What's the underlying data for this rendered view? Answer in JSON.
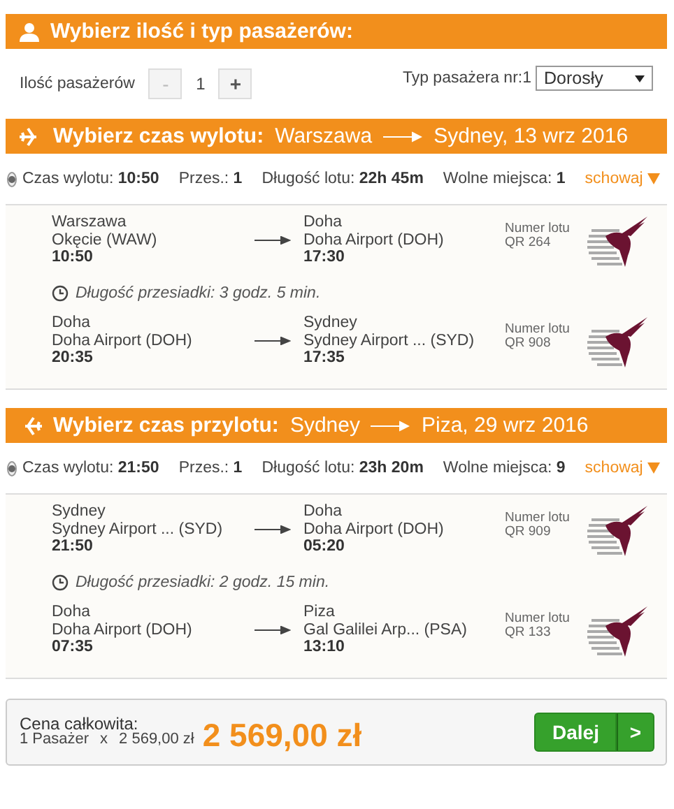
{
  "passengers": {
    "title": "Wybierz ilość i typ pasażerów:",
    "count_label": "Ilość pasażerów",
    "minus": "-",
    "count": "1",
    "plus": "+",
    "minus_disabled": true,
    "type_label": "Typ pasażera nr:1",
    "type_value": "Dorosły"
  },
  "flights": [
    {
      "kind": "outbound",
      "title": "Wybierz czas wylotu:",
      "from": "Warszawa",
      "to": "Sydney, 13 wrz 2016",
      "summary": {
        "selected": true,
        "time_label": "Czas wylotu:",
        "time": "10:50",
        "stops_label": "Przes.:",
        "stops": "1",
        "duration_label": "Długość lotu:",
        "duration": "22h 45m",
        "seats_label": "Wolne miejsca:",
        "seats": "1",
        "toggle": "schowaj",
        "expanded": true
      },
      "legs": [
        {
          "kind": "segment",
          "from_city": "Warszawa",
          "from_airport": "Okęcie (WAW)",
          "from_time": "10:50",
          "to_city": "Doha",
          "to_airport": "Doha Airport (DOH)",
          "to_time": "17:30",
          "number_label": "Numer lotu",
          "number": "QR 264"
        },
        {
          "kind": "layover",
          "text": "Długość przesiadki: 3 godz. 5 min."
        },
        {
          "kind": "segment",
          "from_city": "Doha",
          "from_airport": "Doha Airport (DOH)",
          "from_time": "20:35",
          "to_city": "Sydney",
          "to_airport": "Sydney Airport ... (SYD)",
          "to_time": "17:35",
          "number_label": "Numer lotu",
          "number": "QR 908"
        }
      ]
    },
    {
      "kind": "return",
      "title": "Wybierz czas przylotu:",
      "from": "Sydney",
      "to": "Piza, 29 wrz 2016",
      "summary": {
        "selected": true,
        "time_label": "Czas wylotu:",
        "time": "21:50",
        "stops_label": "Przes.:",
        "stops": "1",
        "duration_label": "Długość lotu:",
        "duration": "23h 20m",
        "seats_label": "Wolne miejsca:",
        "seats": "9",
        "toggle": "schowaj",
        "expanded": true
      },
      "legs": [
        {
          "kind": "segment",
          "from_city": "Sydney",
          "from_airport": "Sydney Airport ... (SYD)",
          "from_time": "21:50",
          "to_city": "Doha",
          "to_airport": "Doha Airport (DOH)",
          "to_time": "05:20",
          "number_label": "Numer lotu",
          "number": "QR 909"
        },
        {
          "kind": "layover",
          "text": "Długość przesiadki: 2 godz. 15 min."
        },
        {
          "kind": "segment",
          "from_city": "Doha",
          "from_airport": "Doha Airport (DOH)",
          "from_time": "07:35",
          "to_city": "Piza",
          "to_airport": "Gal Galilei Arp... (PSA)",
          "to_time": "13:10",
          "number_label": "Numer lotu",
          "number": "QR 133"
        }
      ]
    }
  ],
  "total": {
    "label": "Cena całkowita:",
    "passengers": "1 Pasażer",
    "times": "x",
    "unit_price": "2 569,00 zł",
    "amount": "2 569,00 zł",
    "button": "Dalej",
    "button_arrow": ">"
  }
}
